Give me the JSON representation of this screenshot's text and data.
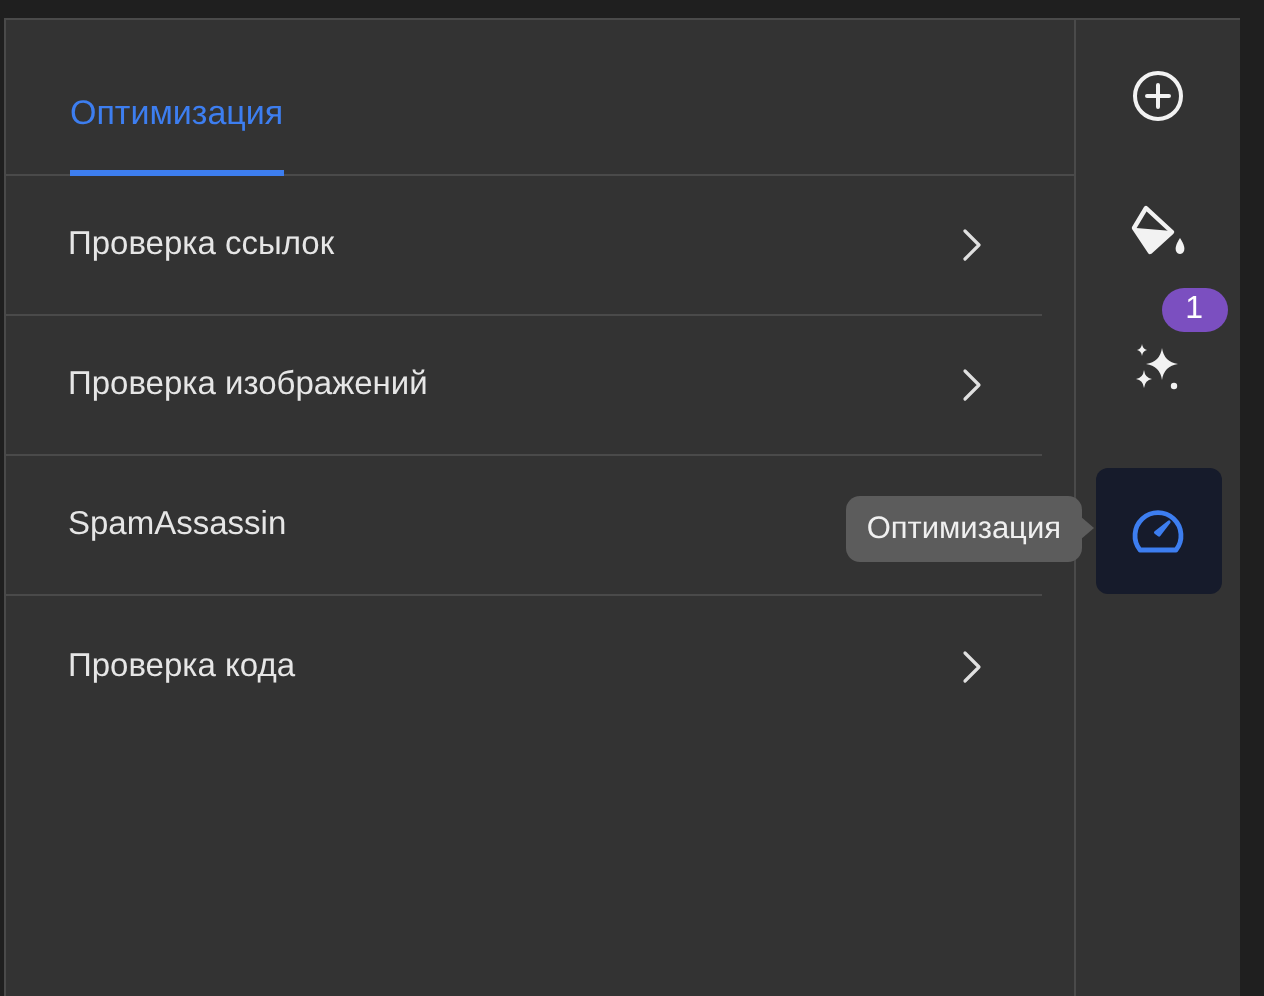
{
  "tabs": [
    {
      "label": "Оптимизация",
      "selected": true
    }
  ],
  "items": [
    {
      "label": "Проверка ссылок",
      "chevron": true
    },
    {
      "label": "Проверка изображений",
      "chevron": true
    },
    {
      "label": "SpamAssassin",
      "chevron": false
    },
    {
      "label": "Проверка кода",
      "chevron": true
    }
  ],
  "rail": [
    {
      "kind": "add",
      "selected": false
    },
    {
      "kind": "paint",
      "selected": false
    },
    {
      "kind": "sparkles",
      "selected": false,
      "badge": "1"
    },
    {
      "kind": "gauge",
      "selected": true,
      "tooltip": "Оптимизация"
    }
  ]
}
